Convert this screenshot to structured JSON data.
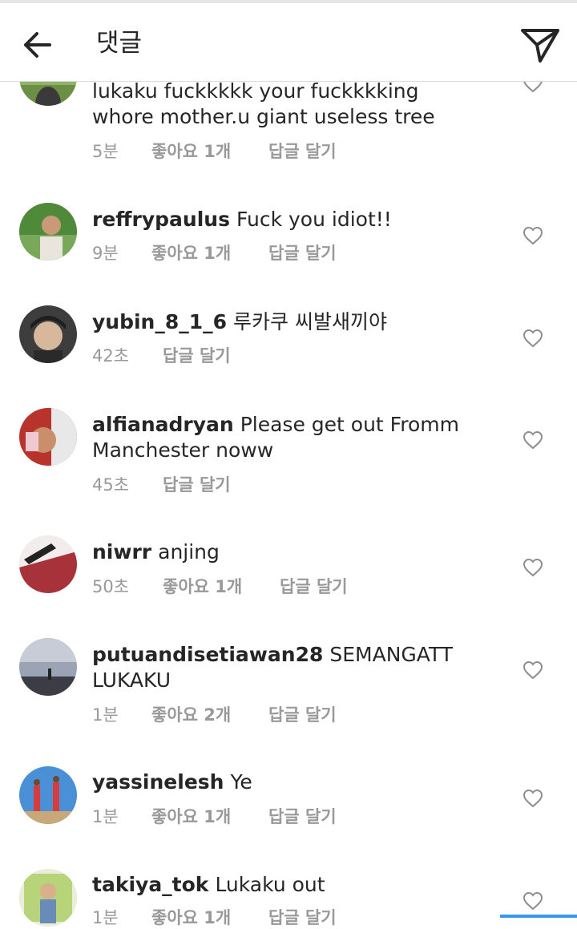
{
  "header": {
    "title": "댓글",
    "back_icon": "arrow-left-icon",
    "send_icon": "paper-plane-icon"
  },
  "comments": [
    {
      "username": "",
      "text": "lukaku fuckkkkk your fuckkkking whore mother.u giant useless tree",
      "time": "5분",
      "likes": "좋아요 1개",
      "reply": "답글 달기"
    },
    {
      "username": "reffrypaulus",
      "text": "Fuck you idiot!!",
      "time": "9분",
      "likes": "좋아요 1개",
      "reply": "답글 달기"
    },
    {
      "username": "yubin_8_1_6",
      "text": "루카쿠 씨발새끼야",
      "time": "42초",
      "likes": "",
      "reply": "답글 달기"
    },
    {
      "username": "alfianadryan",
      "text": "Please get out Fromm Manchester noww",
      "time": "45초",
      "likes": "",
      "reply": "답글 달기"
    },
    {
      "username": "niwrr",
      "text": "anjing",
      "time": "50초",
      "likes": "좋아요 1개",
      "reply": "답글 달기"
    },
    {
      "username": "putuandisetiawan28",
      "text": "SEMANGATT LUKAKU",
      "time": "1분",
      "likes": "좋아요 2개",
      "reply": "답글 달기"
    },
    {
      "username": "yassinelesh",
      "text": "Ye",
      "time": "1분",
      "likes": "좋아요 1개",
      "reply": "답글 달기"
    },
    {
      "username": "takiya_tok",
      "text": "Lukaku out",
      "time": "1분",
      "likes": "좋아요 1개",
      "reply": "답글 달기"
    }
  ],
  "colors": {
    "text": "#262626",
    "meta": "#999999",
    "accent": "#3897f0",
    "divider": "#dbdbdb"
  }
}
